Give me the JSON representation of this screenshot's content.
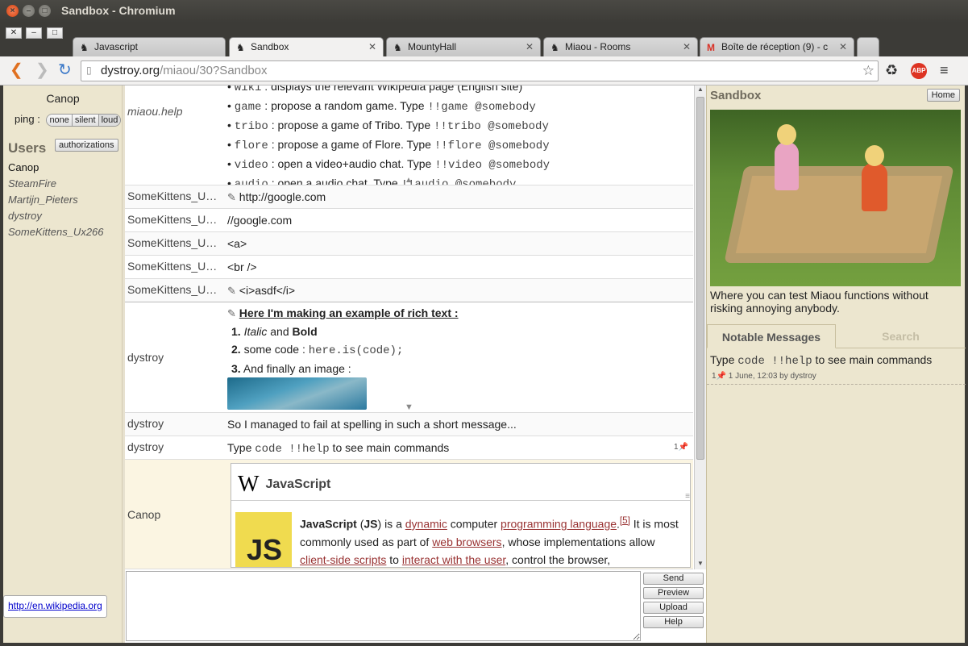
{
  "window": {
    "title": "Sandbox - Chromium"
  },
  "tabs": [
    {
      "label": "Javascript",
      "icon": "miaou-icon"
    },
    {
      "label": "Sandbox",
      "icon": "miaou-icon",
      "active": true
    },
    {
      "label": "MountyHall",
      "icon": "miaou-icon"
    },
    {
      "label": "Miaou - Rooms",
      "icon": "miaou-icon"
    },
    {
      "label": "Boîte de réception (9) - c",
      "icon": "gmail-icon"
    }
  ],
  "url": {
    "domain": "dystroy.org",
    "path": "/miaou/30?Sandbox"
  },
  "sidebar": {
    "me": "Canop",
    "ping_label": "ping :",
    "ping_options": [
      "none",
      "silent",
      "loud"
    ],
    "users_heading": "Users",
    "authorizations_label": "authorizations",
    "users": [
      "Canop",
      "SteamFire",
      "Martijn_Pieters",
      "dystroy",
      "SomeKittens_Ux266"
    ],
    "status_link": "http://en.wikipedia.org"
  },
  "messages": {
    "help_author": "miaou.help",
    "help_lines": [
      {
        "cmd": "wiki",
        "text": " : displays the relevant Wikipedia page (English site)"
      },
      {
        "cmd": "game",
        "text": " : propose a random game. Type ",
        "code": "!!game @somebody"
      },
      {
        "cmd": "tribo",
        "text": " : propose a game of Tribo. Type ",
        "code": "!!tribo @somebody"
      },
      {
        "cmd": "flore",
        "text": " : propose a game of Flore. Type ",
        "code": "!!flore @somebody"
      },
      {
        "cmd": "video",
        "text": " : open a video+audio chat. Type ",
        "code": "!!video @somebody"
      },
      {
        "cmd": "audio",
        "text": " : open a audio chat. Type ",
        "code": "!!audio @somebody"
      }
    ],
    "list": [
      {
        "author": "SomeKittens_Ux266",
        "text": "http://google.com",
        "edited": true
      },
      {
        "author": "SomeKittens_Ux266",
        "text": "//google.com"
      },
      {
        "author": "SomeKittens_Ux266",
        "text": "<a>"
      },
      {
        "author": "SomeKittens_Ux266",
        "text": "<br />"
      },
      {
        "author": "SomeKittens_Ux266",
        "text": "<i>asdf</i>",
        "edited": true
      }
    ],
    "rich": {
      "author": "dystroy",
      "title": "Here I'm making an example of rich text :",
      "item1_italic": "Italic",
      "item1_and": " and ",
      "item1_bold": "Bold",
      "item2_text": "some code : ",
      "item2_code": "here.is(code);",
      "item3_text": "And finally an image :"
    },
    "spell": {
      "author": "dystroy",
      "text": "So I managed to fail at spelling in such a short message..."
    },
    "typecode": {
      "author": "dystroy",
      "pre": "Type ",
      "code": "code !!help",
      "post": " to see main commands",
      "pin_count": "1"
    },
    "wiki": {
      "author": "Canop",
      "logo": "W",
      "title": "JavaScript",
      "js_logo": "JS",
      "p1": "JavaScript",
      "p2": " (",
      "p3": "JS",
      "p4": ") is a ",
      "l1": "dynamic",
      "p5": " computer ",
      "l2": "programming language",
      "ref": "[5]",
      "p6": " It is most commonly used as part of ",
      "l3": "web browsers",
      "p7": ", whose implementations allow ",
      "l4": "client-side scripts",
      "p8": " to ",
      "l5": "interact with the user",
      "p9": ", control the browser,"
    }
  },
  "buttons": {
    "send": "Send",
    "preview": "Preview",
    "upload": "Upload",
    "help": "Help"
  },
  "right": {
    "title": "Sandbox",
    "home": "Home",
    "description": "Where you can test Miaou functions without risking annoying anybody.",
    "tab_notable": "Notable Messages",
    "tab_search": "Search",
    "notable_pre": "Type ",
    "notable_code": "code !!help",
    "notable_post": " to see main commands",
    "notable_meta": "1 June, 12:03 by dystroy",
    "notable_count": "1"
  }
}
